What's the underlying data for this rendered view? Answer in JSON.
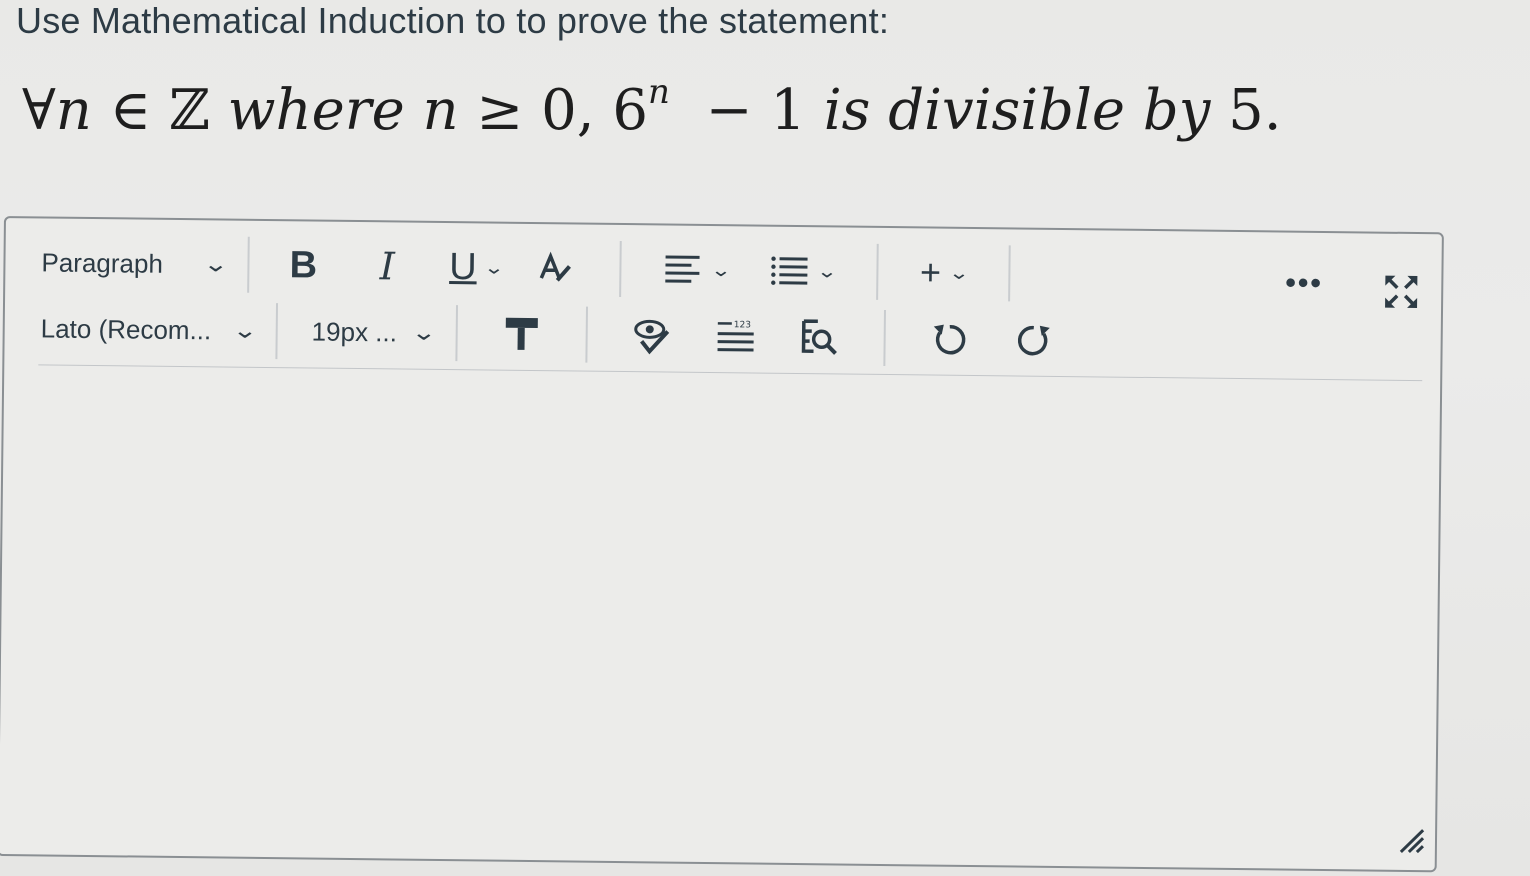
{
  "question": {
    "prompt": "Use Mathematical Induction to to prove the statement:",
    "math": {
      "forall": "∀",
      "var_n": "n",
      "elem": "∈",
      "integers": "ℤ",
      "where": "where",
      "var_n2": "n",
      "geq": "≥",
      "zero": "0,",
      "base": "6",
      "exponent": "n",
      "minus": "−",
      "one": "1",
      "rest": "is divisible by",
      "five": "5."
    }
  },
  "toolbar": {
    "block_format": "Paragraph",
    "font_family": "Lato (Recom...",
    "font_size": "19px ...",
    "bold_label": "B",
    "italic_label": "I",
    "underline_label": "U",
    "more_label": "•••"
  },
  "icons": {
    "chevron": "chevron-down-icon",
    "text_color": "text-color-icon",
    "align": "align-icon",
    "list": "bullet-list-icon",
    "insert": "plus-icon",
    "clear_format": "clear-format-icon",
    "accessibility": "accessibility-checker-icon",
    "word_count": "word-count-icon",
    "find_replace": "find-replace-icon",
    "undo": "undo-icon",
    "redo": "redo-icon",
    "fullscreen": "fullscreen-icon",
    "resize": "resize-handle-icon"
  },
  "editor": {
    "content": ""
  }
}
